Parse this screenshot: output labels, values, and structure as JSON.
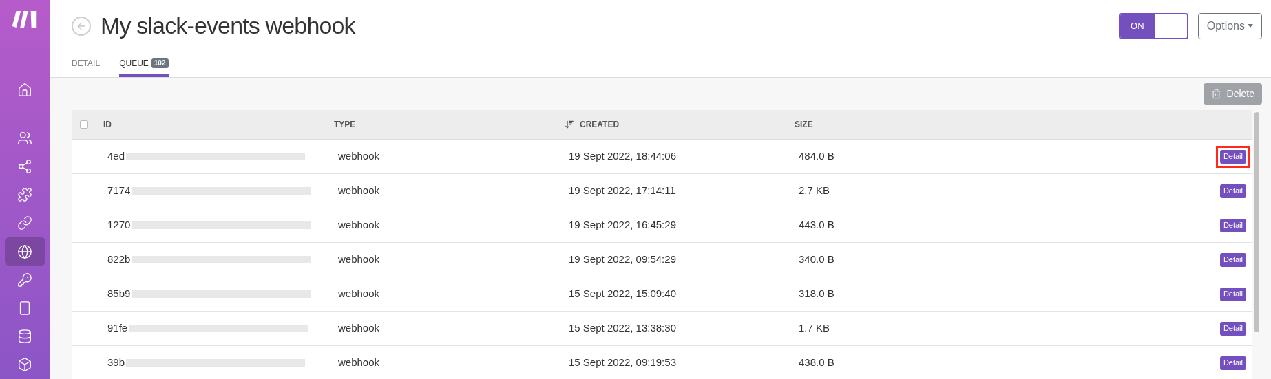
{
  "sidebar": {
    "items": [
      {
        "kind": "home",
        "selected": false
      },
      {
        "kind": "users",
        "selected": false
      },
      {
        "kind": "share",
        "selected": false
      },
      {
        "kind": "puzzle",
        "selected": false
      },
      {
        "kind": "link",
        "selected": false
      },
      {
        "kind": "globe",
        "selected": true
      },
      {
        "kind": "key",
        "selected": false
      },
      {
        "kind": "phone",
        "selected": false
      },
      {
        "kind": "database",
        "selected": false
      },
      {
        "kind": "box",
        "selected": false
      }
    ]
  },
  "header": {
    "title": "My slack-events webhook",
    "toggle": {
      "label": "ON",
      "on": true
    },
    "options_button": "Options"
  },
  "tabs": [
    {
      "label": "DETAIL",
      "selected": false
    },
    {
      "label": "QUEUE",
      "badge": "102",
      "selected": true
    }
  ],
  "toolbar": {
    "delete_button": {
      "label": "Delete",
      "disabled": true
    }
  },
  "table": {
    "select_all": {
      "checked": false
    },
    "columns": [
      "ID",
      "TYPE",
      "CREATED",
      "SIZE"
    ],
    "rows": [
      {
        "id": "4ed",
        "type": "webhook",
        "created": "19 Sept 2022, 18:44:06",
        "size": "484.0 B",
        "action": "Detail",
        "highlighted": true
      },
      {
        "id": "7174",
        "type": "webhook",
        "created": "19 Sept 2022, 17:14:11",
        "size": "2.7 KB",
        "action": "Detail",
        "highlighted": false
      },
      {
        "id": "1270",
        "type": "webhook",
        "created": "19 Sept 2022, 16:45:29",
        "size": "443.0 B",
        "action": "Detail",
        "highlighted": false
      },
      {
        "id": "822b",
        "type": "webhook",
        "created": "19 Sept 2022, 09:54:29",
        "size": "340.0 B",
        "action": "Detail",
        "highlighted": false
      },
      {
        "id": "85b9",
        "type": "webhook",
        "created": "15 Sept 2022, 15:09:40",
        "size": "318.0 B",
        "action": "Detail",
        "highlighted": false
      },
      {
        "id": "91fe",
        "type": "webhook",
        "created": "15 Sept 2022, 13:38:30",
        "size": "1.7 KB",
        "action": "Detail",
        "highlighted": false
      },
      {
        "id": "39b",
        "type": "webhook",
        "created": "15 Sept 2022, 09:19:53",
        "size": "438.0 B",
        "action": "Detail",
        "highlighted": false
      }
    ]
  }
}
